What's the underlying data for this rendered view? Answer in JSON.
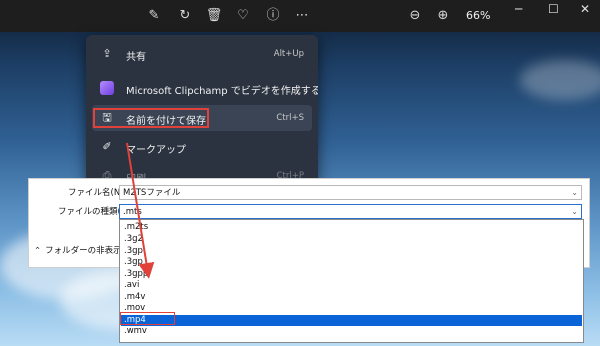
{
  "toolbar": {
    "zoom": "66%",
    "icons": [
      "edit-icon",
      "rotate-icon",
      "delete-icon",
      "favorite-icon",
      "info-icon",
      "more-icon",
      "zoom-out-icon",
      "zoom-in-icon"
    ],
    "window_controls": [
      "minimize-icon",
      "maximize-icon",
      "close-icon"
    ]
  },
  "context_menu": {
    "items": [
      {
        "label": "共有",
        "shortcut": "Alt+Up",
        "icon": "share-icon"
      },
      {
        "label": "Microsoft Clipchamp でビデオを作成する",
        "shortcut": "",
        "icon": "clipchamp-icon"
      },
      {
        "label": "名前を付けて保存",
        "shortcut": "Ctrl+S",
        "icon": "save-icon"
      },
      {
        "label": "マークアップ",
        "shortcut": "",
        "icon": "markup-icon"
      },
      {
        "label": "印刷",
        "shortcut": "Ctrl+P",
        "icon": "print-icon"
      }
    ]
  },
  "save_dialog": {
    "filename_label": "ファイル名(N):",
    "filename_value": "M2TSファイル",
    "filetype_label": "ファイルの種類(T):",
    "filetype_value": ".mts",
    "hide_folders": "フォルダーの非表示"
  },
  "filetype_list": {
    "options": [
      ".m2ts",
      ".3g2",
      ".3gp",
      ".3gp",
      ".3gpp",
      ".avi",
      ".m4v",
      ".mov",
      ".mp4",
      ".wmv"
    ],
    "selected_index": 8
  },
  "colors": {
    "highlight_red": "#e0413a",
    "selection_blue": "#0a64d8",
    "menu_bg": "#2b3340"
  }
}
